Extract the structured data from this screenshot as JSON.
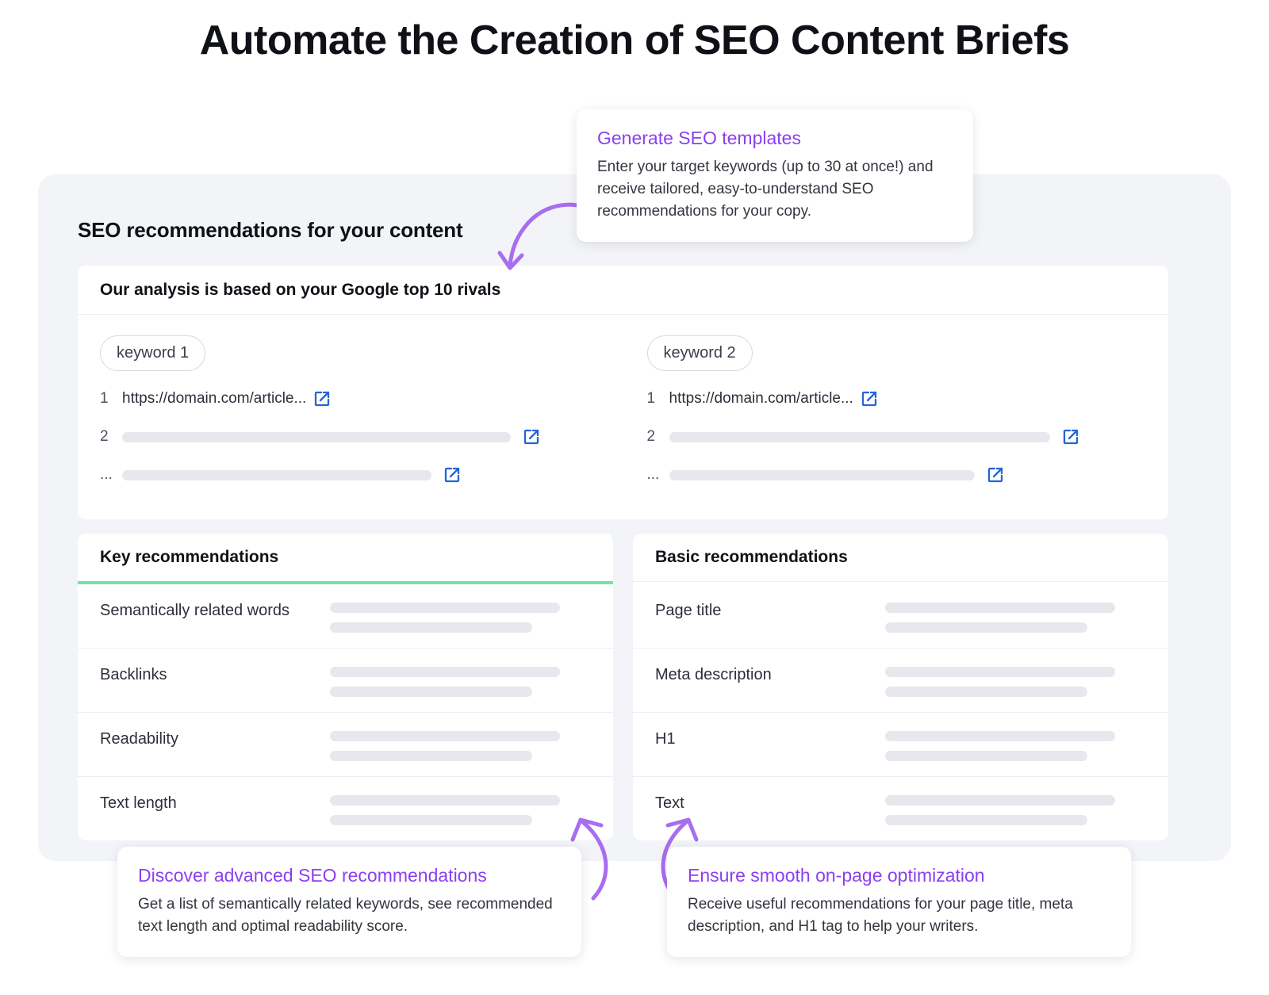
{
  "page": {
    "title": "Automate the Creation of SEO Content Briefs"
  },
  "colors": {
    "accent_purple": "#8b3ff0",
    "accent_green": "#77e2a2",
    "link_blue": "#2563d9",
    "panel_bg": "#f3f4f8",
    "placeholder_grey": "#e7e8ed"
  },
  "panel": {
    "title": "SEO recommendations for your content"
  },
  "rivals_card": {
    "header": "Our analysis is based on your Google top 10 rivals",
    "columns": [
      {
        "keyword": "keyword 1",
        "rows": [
          {
            "index": "1",
            "url": "https://domain.com/article...",
            "masked": false
          },
          {
            "index": "2",
            "url": "",
            "masked": true
          },
          {
            "index": "...",
            "url": "",
            "masked": true
          }
        ]
      },
      {
        "keyword": "keyword 2",
        "rows": [
          {
            "index": "1",
            "url": "https://domain.com/article...",
            "masked": false
          },
          {
            "index": "2",
            "url": "",
            "masked": true
          },
          {
            "index": "...",
            "url": "",
            "masked": true
          }
        ]
      }
    ]
  },
  "recommendations": {
    "key": {
      "header": "Key recommendations",
      "accent": "green",
      "items": [
        "Semantically related words",
        "Backlinks",
        "Readability",
        "Text length"
      ]
    },
    "basic": {
      "header": "Basic recommendations",
      "accent": "grey",
      "items": [
        "Page title",
        "Meta description",
        "H1",
        "Text"
      ]
    }
  },
  "tooltips": {
    "top": {
      "title": "Generate SEO templates",
      "body": "Enter your target keywords (up to 30 at once!) and receive tailored, easy-to-understand SEO recommendations for your copy."
    },
    "left": {
      "title": "Discover advanced SEO recommendations",
      "body": "Get a list of semantically related keywords, see recommended text length and optimal readability score."
    },
    "right": {
      "title": "Ensure smooth on-page optimization",
      "body": "Receive useful recommendations for your page title, meta description, and H1 tag to help your writers."
    }
  }
}
